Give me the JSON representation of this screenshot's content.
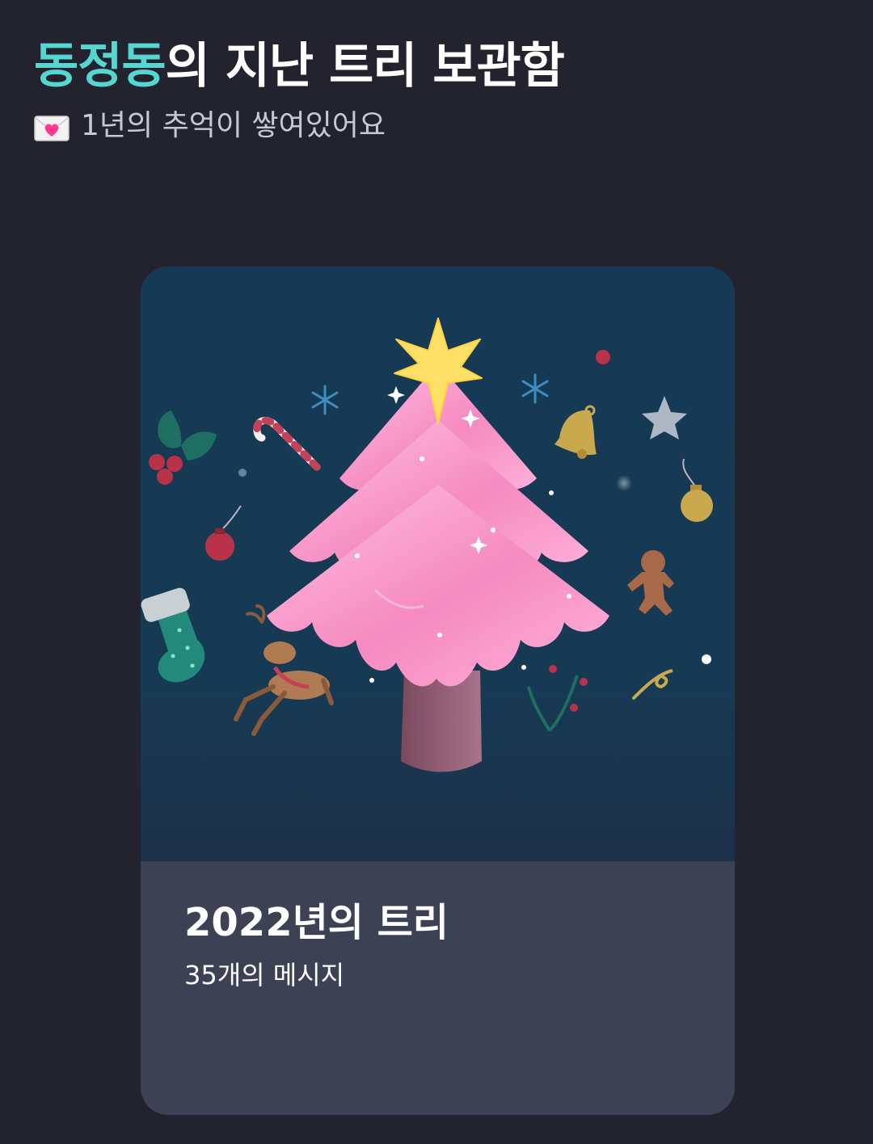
{
  "header": {
    "owner_name": "동정동",
    "title_rest": "의 지난 트리 보관함",
    "subtitle": "1년의 추억이 쌓여있어요",
    "subtitle_icon": "love-letter-icon"
  },
  "archive": {
    "cards": [
      {
        "title": "2022년의 트리",
        "message_count": "35개의 메시지",
        "art": "pink-christmas-tree-illustration"
      }
    ]
  },
  "colors": {
    "background": "#22232f",
    "accent": "#55d6cf",
    "card_art_bg": "#163a55",
    "card_info_bg": "#3c4154",
    "tree_pink": "#f48fc0",
    "star_yellow": "#ffe066"
  }
}
